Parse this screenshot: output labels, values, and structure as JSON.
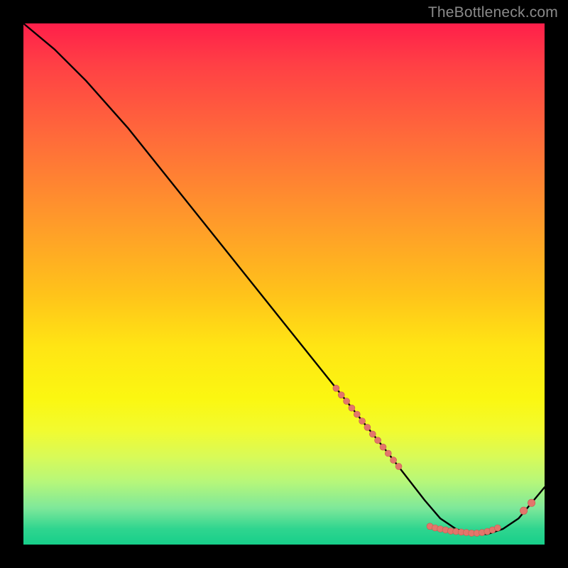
{
  "attribution": "TheBottleneck.com",
  "colors": {
    "page_bg": "#000000",
    "text": "#8a8a8a",
    "curve": "#000000",
    "marker_fill": "#e2766b",
    "marker_stroke": "#c95a50",
    "gradient_stops": [
      "#ff1f4a",
      "#ff4045",
      "#ff6b3a",
      "#ff9a2a",
      "#ffc31a",
      "#ffe514",
      "#fbf711",
      "#f2fb2f",
      "#d9fa57",
      "#b6f77a",
      "#7ee89a",
      "#2fd58f",
      "#17cf8a"
    ]
  },
  "chart_data": {
    "type": "line",
    "title": "",
    "xlabel": "",
    "ylabel": "",
    "xlim": [
      0,
      100
    ],
    "ylim": [
      0,
      100
    ],
    "grid": false,
    "legend": false,
    "series": [
      {
        "name": "curve",
        "x": [
          0,
          6,
          12,
          20,
          30,
          40,
          50,
          60,
          70,
          77,
          80,
          83,
          86,
          89,
          92,
          95,
          100
        ],
        "values": [
          100,
          95,
          89,
          80,
          67.5,
          55,
          42.5,
          30,
          17.5,
          8.5,
          5,
          3,
          2,
          2,
          3,
          5,
          11
        ]
      }
    ],
    "markers": {
      "descending_cluster": {
        "x": [
          60,
          61,
          62,
          63,
          64,
          65,
          66,
          67,
          68,
          69,
          70,
          71,
          72
        ],
        "values": [
          30,
          28.7,
          27.5,
          26.2,
          25,
          23.7,
          22.5,
          21.2,
          20,
          18.7,
          17.5,
          16.2,
          15
        ]
      },
      "valley_cluster": {
        "x": [
          78,
          79,
          80,
          81,
          82,
          83,
          84,
          85,
          86,
          87,
          88,
          89,
          90,
          91
        ],
        "values": [
          3.5,
          3.2,
          3.0,
          2.8,
          2.6,
          2.5,
          2.4,
          2.3,
          2.2,
          2.2,
          2.3,
          2.5,
          2.8,
          3.2
        ]
      },
      "ascending_pair": {
        "x": [
          96,
          97.5
        ],
        "values": [
          6.5,
          8.0
        ]
      }
    }
  }
}
